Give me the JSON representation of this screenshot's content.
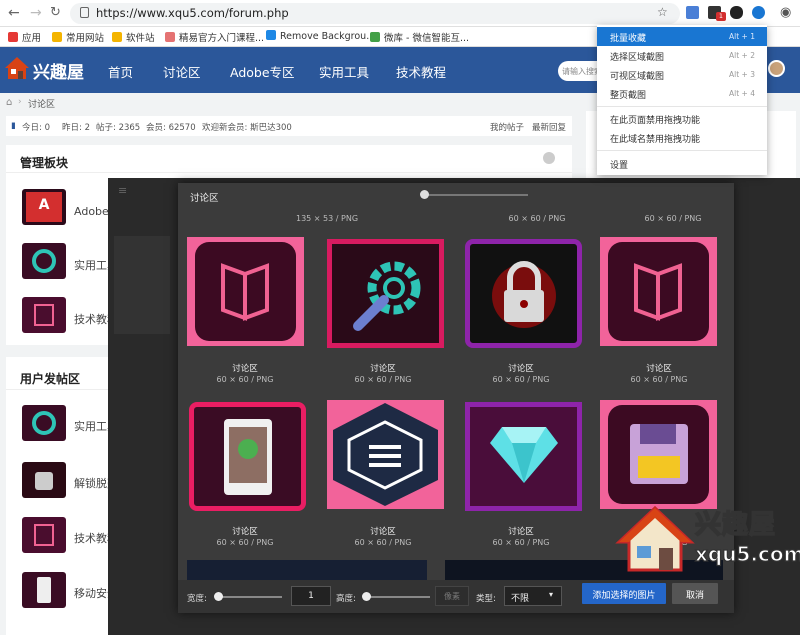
{
  "browser": {
    "url": "https://www.xqu5.com/forum.php",
    "ext_badge": "1"
  },
  "bookmarks": [
    {
      "label": "应用",
      "icon": "apps-grid-icon",
      "color": "#e53935"
    },
    {
      "label": "常用网站",
      "icon": "folder-icon",
      "color": "#f4b400"
    },
    {
      "label": "软件站",
      "icon": "folder-icon",
      "color": "#f4b400"
    },
    {
      "label": "精易官方入门课程...",
      "icon": "site-icon",
      "color": "#e57373"
    },
    {
      "label": "Remove Backgrou...",
      "icon": "site-icon",
      "color": "#1e88e5"
    },
    {
      "label": "微库 - 微信智能互...",
      "icon": "cloud-icon",
      "color": "#43a047"
    }
  ],
  "site": {
    "logo_text": "兴趣屋",
    "nav": [
      "首页",
      "讨论区",
      "Adobe专区",
      "实用工具",
      "技术教程"
    ],
    "search_placeholder": "请输入搜索",
    "accent": "#2b579a"
  },
  "breadcrumb": {
    "current": "讨论区"
  },
  "stats": {
    "today": "今日: 0",
    "yesterday": "昨日: 2",
    "posts": "帖子: 2365",
    "members": "会员: 62570",
    "welcome": "欢迎新会员: 斯巴达300",
    "my_posts": "我的帖子",
    "latest_replies": "最新回复"
  },
  "admin_section": {
    "title": "管理板块",
    "items": [
      "Adobe专",
      "实用工具",
      "技术教程"
    ]
  },
  "user_section": {
    "title": "用户发帖区",
    "items": [
      "实用工具",
      "解锁脱壳",
      "技术教程",
      "移动安全"
    ]
  },
  "capture_menu": {
    "items": [
      {
        "label": "批量收藏",
        "key": "Alt + 1",
        "active": true
      },
      {
        "label": "选择区域截图",
        "key": "Alt + 2"
      },
      {
        "label": "可视区域截图",
        "key": "Alt + 3"
      },
      {
        "label": "整页截图",
        "key": "Alt + 4"
      }
    ],
    "options": [
      "在此页面禁用拖拽功能",
      "在此域名禁用拖拽功能"
    ],
    "settings": "设置"
  },
  "dialog": {
    "title": "讨论区",
    "top_meta": [
      "135 × 53 / PNG",
      "60 × 60 / PNG",
      "60 × 60 / PNG"
    ],
    "rows": [
      [
        {
          "name": "讨论区",
          "meta": "60 × 60 / PNG",
          "icon": "book-icon"
        },
        {
          "name": "讨论区",
          "meta": "60 × 60 / PNG",
          "icon": "wrench-gear-icon"
        },
        {
          "name": "讨论区",
          "meta": "60 × 60 / PNG",
          "icon": "padlock-icon"
        },
        {
          "name": "讨论区",
          "meta": "60 × 60 / PNG",
          "icon": "book-icon"
        }
      ],
      [
        {
          "name": "讨论区",
          "meta": "60 × 60 / PNG",
          "icon": "phone-icon"
        },
        {
          "name": "讨论区",
          "meta": "60 × 60 / PNG",
          "icon": "menu-hexagon-icon"
        },
        {
          "name": "讨论区",
          "meta": "60 × 60 / PNG",
          "icon": "diamond-icon"
        },
        {
          "name": "讨论区",
          "meta": "60 × 60 / PNG",
          "icon": "floppy-disk-icon"
        }
      ]
    ],
    "footer": {
      "width_label": "宽度:",
      "width_value": "1",
      "height_label": "高度:",
      "height_value": "像素",
      "type_label": "类型:",
      "type_value": "不限",
      "add_button": "添加选择的图片",
      "cancel_button": "取消"
    }
  },
  "watermark": {
    "title": "兴趣屋",
    "url": "xqu5.com"
  }
}
